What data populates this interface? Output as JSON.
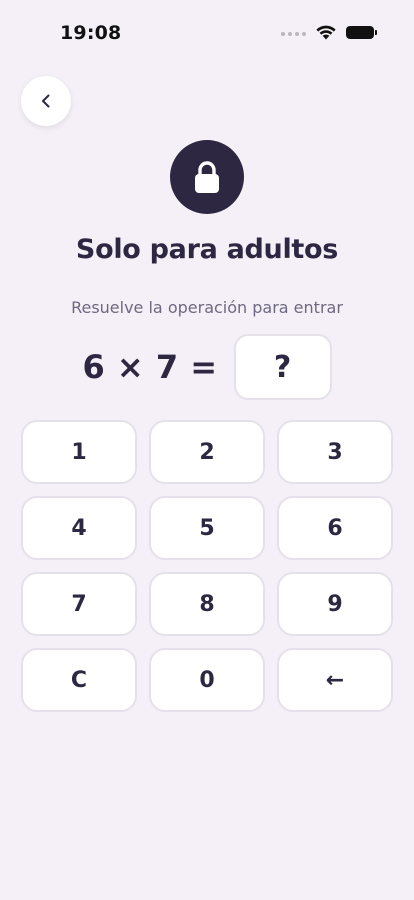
{
  "status_bar": {
    "time": "19:08"
  },
  "header": {
    "title": "Solo para adultos",
    "subtitle": "Resuelve la operación para entrar"
  },
  "problem": {
    "expression": "6 × 7 =",
    "answer_placeholder": "?"
  },
  "keypad": {
    "keys": [
      "1",
      "2",
      "3",
      "4",
      "5",
      "6",
      "7",
      "8",
      "9",
      "C",
      "0",
      "←"
    ]
  },
  "icons": {
    "back": "chevron-left-icon",
    "lock": "lock-icon"
  },
  "colors": {
    "background": "#f5f0f7",
    "primary_dark": "#2d2742",
    "key_background": "#ffffff",
    "key_border": "#e6e0ea",
    "muted_text": "#6e6880"
  }
}
